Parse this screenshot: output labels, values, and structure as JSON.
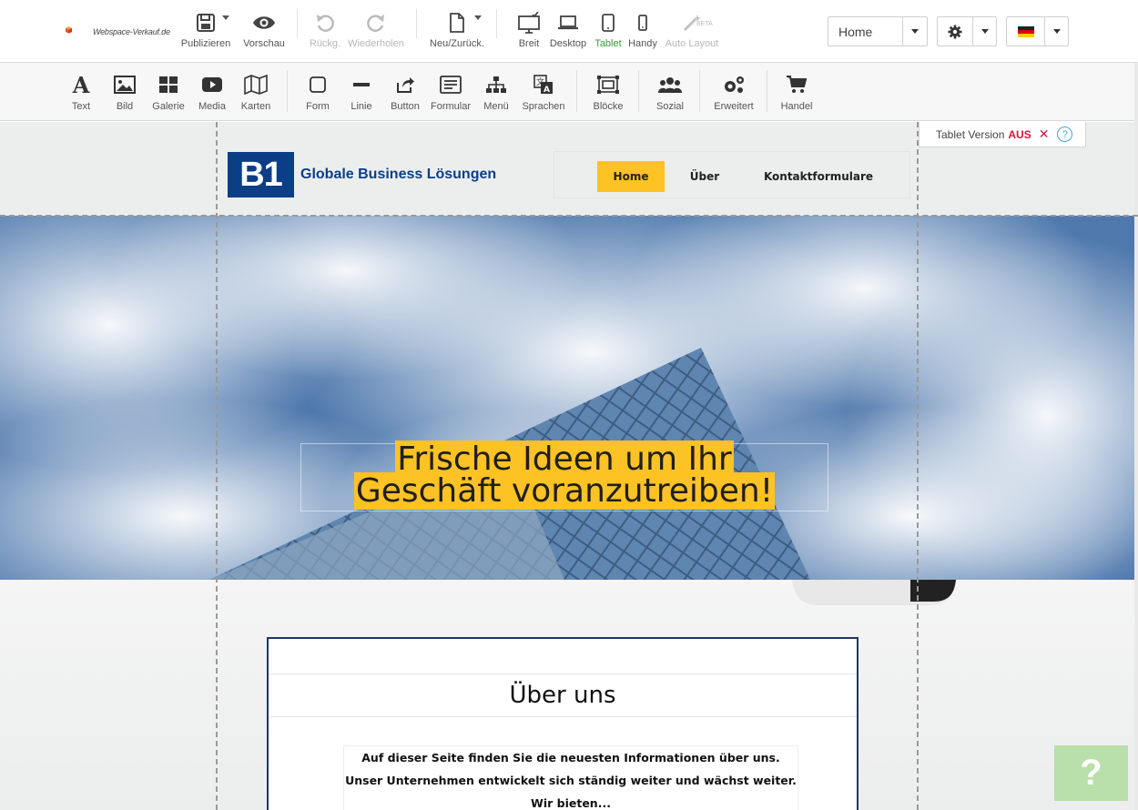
{
  "app": {
    "logo_text": "Webspace-Verkauf.de"
  },
  "toolbar": {
    "publish": "Publizieren",
    "preview": "Vorschau",
    "undo": "Rückg.",
    "redo": "Wiederholen",
    "new": "Neu/Zurück.",
    "wide": "Breit",
    "desktop": "Desktop",
    "tablet": "Tablet",
    "mobile": "Handy",
    "autolayout": "Auto Layout",
    "autolayout_badge": "BETA",
    "page_select": "Home"
  },
  "elements": {
    "text": "Text",
    "image": "Bild",
    "gallery": "Galerie",
    "media": "Media",
    "maps": "Karten",
    "shape": "Form",
    "line": "Linie",
    "button": "Button",
    "form": "Formular",
    "menu": "Menü",
    "languages": "Sprachen",
    "blocks": "Blöcke",
    "social": "Sozial",
    "advanced": "Erweitert",
    "commerce": "Handel"
  },
  "tablet_badge": {
    "label": "Tablet Version",
    "state": "AUS",
    "close": "✕",
    "help": "?"
  },
  "site": {
    "logo_mark": "B1",
    "brand": "Globale Business Lösungen",
    "nav": [
      "Home",
      "Über",
      "Kontaktformulare"
    ],
    "headline_line1": "Frische Ideen um Ihr",
    "headline_line2": "Geschäft voranzutreiben!",
    "about_title": "Über uns",
    "about_text": "Auf dieser Seite finden Sie die neuesten Informationen über uns. Unser Unternehmen entwickelt sich ständig weiter und wächst weiter. Wir bieten..."
  },
  "help_button": "?",
  "colors": {
    "accent_yellow": "#fdc223",
    "brand_blue": "#0b3e86",
    "active_green": "#3a9a3a",
    "danger_red": "#d2173b"
  }
}
